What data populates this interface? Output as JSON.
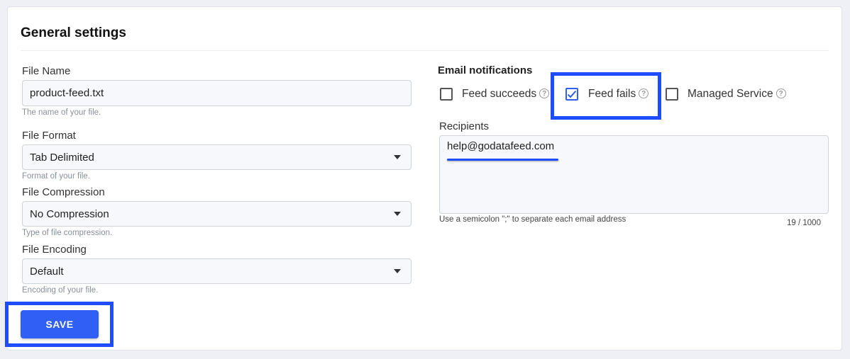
{
  "section": {
    "title": "General settings"
  },
  "file_name": {
    "label": "File Name",
    "value": "product-feed.txt",
    "hint": "The name of your file."
  },
  "file_format": {
    "label": "File Format",
    "value": "Tab Delimited",
    "hint": "Format of your file."
  },
  "file_compression": {
    "label": "File Compression",
    "value": "No Compression",
    "hint": "Type of file compression."
  },
  "file_encoding": {
    "label": "File Encoding",
    "value": "Default",
    "hint": "Encoding of your file."
  },
  "save_button": {
    "label": "SAVE"
  },
  "email_notifications": {
    "heading": "Email notifications",
    "options": [
      {
        "label": "Feed succeeds",
        "checked": false
      },
      {
        "label": "Feed fails",
        "checked": true
      },
      {
        "label": "Managed Service",
        "checked": false
      }
    ],
    "help_glyph": "?"
  },
  "recipients": {
    "label": "Recipients",
    "value": "help@godatafeed.com",
    "hint": "Use a semicolon \";\" to separate each email address",
    "counter": "19 / 1000"
  },
  "colors": {
    "accent": "#2f5ff5",
    "highlight": "#1e4dff"
  }
}
